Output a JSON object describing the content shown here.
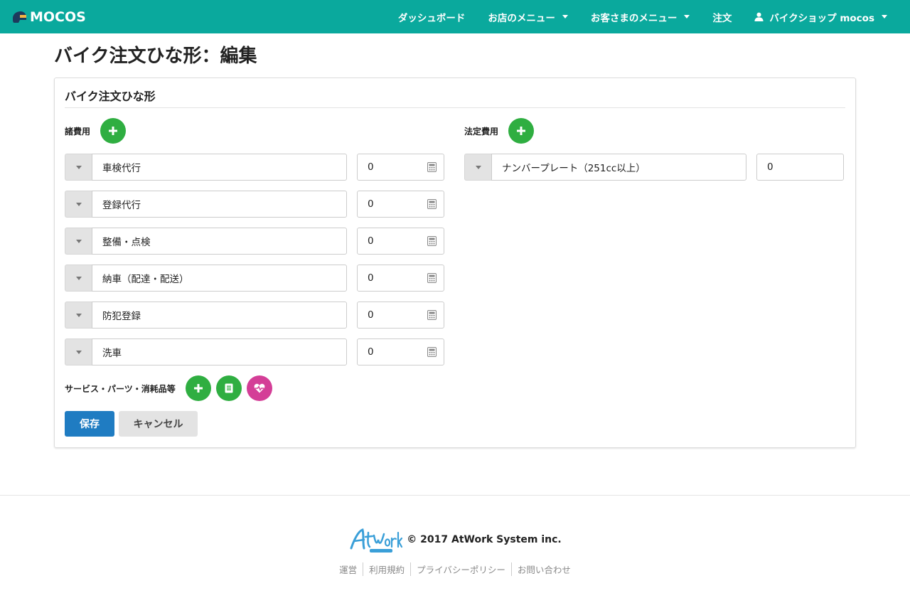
{
  "navbar": {
    "brand": "MOCOS",
    "items": [
      {
        "label": "ダッシュボード"
      },
      {
        "label": "お店のメニュー"
      },
      {
        "label": "お客さまのメニュー"
      },
      {
        "label": "注文"
      }
    ],
    "user": "バイクショップ mocos"
  },
  "page_title": "バイク注文ひな形：編集",
  "panel": {
    "title": "バイク注文ひな形",
    "misc_fees": {
      "label": "諸費用",
      "rows": [
        {
          "name": "車検代行",
          "amount": "0"
        },
        {
          "name": "登録代行",
          "amount": "0"
        },
        {
          "name": "整備・点検",
          "amount": "0"
        },
        {
          "name": "納車（配達・配送）",
          "amount": "0"
        },
        {
          "name": "防犯登録",
          "amount": "0"
        },
        {
          "name": "洗車",
          "amount": "0"
        }
      ]
    },
    "legal_fees": {
      "label": "法定費用",
      "rows": [
        {
          "name": "ナンバープレート（251cc以上）",
          "amount": "0"
        }
      ]
    },
    "services_label": "サービス・パーツ・消耗品等",
    "save_label": "保存",
    "cancel_label": "キャンセル"
  },
  "footer": {
    "copyright": "© 2017 AtWork System inc.",
    "links": [
      "運営",
      "利用規約",
      "プライバシーポリシー",
      "お問い合わせ"
    ]
  },
  "colors": {
    "navbar": "#0aa99d",
    "green_button": "#2fae41",
    "pink_button": "#d43e97",
    "primary_button": "#1f7cc2"
  }
}
